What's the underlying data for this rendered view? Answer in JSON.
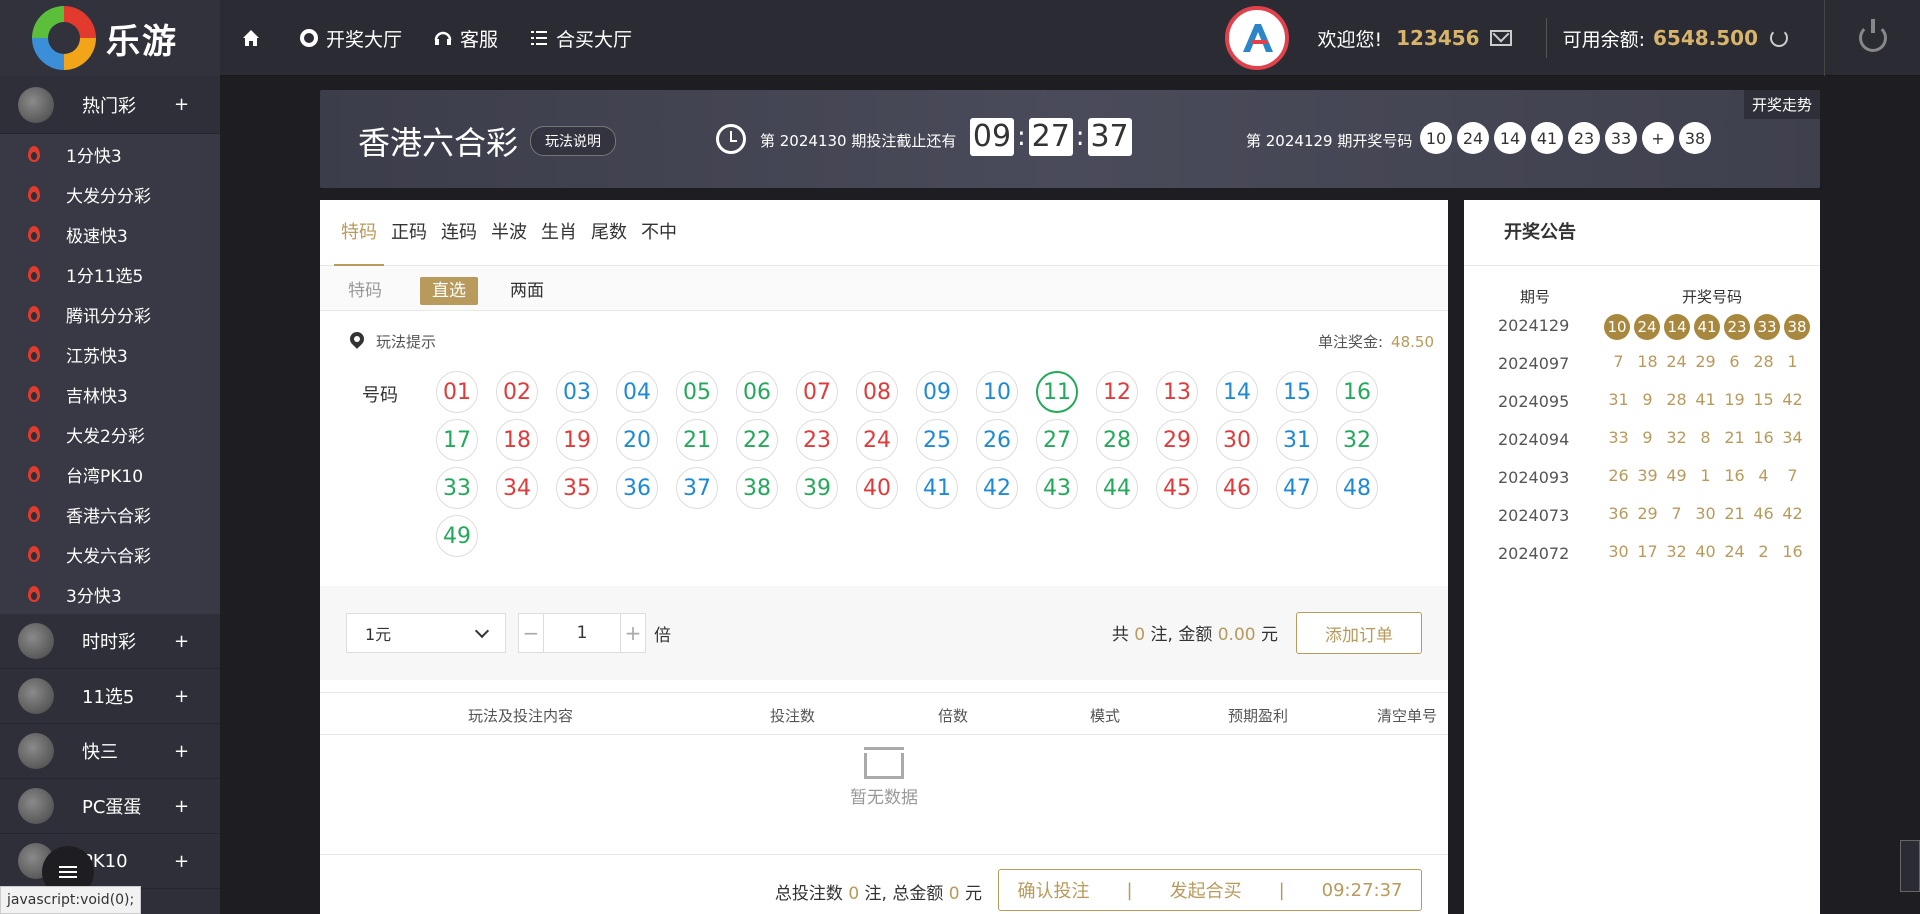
{
  "header": {
    "logo_text": "乐游",
    "nav": [
      {
        "label": "",
        "icon": "home-icon"
      },
      {
        "label": "开奖大厅",
        "icon": "lottery-ball-icon"
      },
      {
        "label": "客服",
        "icon": "headset-icon"
      },
      {
        "label": "合买大厅",
        "icon": "list-icon"
      }
    ],
    "welcome": "欢迎您!",
    "username": "123456",
    "balance_label": "可用余额:",
    "balance": "6548.500"
  },
  "sidebar": {
    "hot": {
      "label": "热门彩",
      "plus": "+"
    },
    "hot_items": [
      "1分快3",
      "大发分分彩",
      "极速快3",
      "1分11选5",
      "腾讯分分彩",
      "江苏快3",
      "吉林快3",
      "大发2分彩",
      "台湾PK10",
      "香港六合彩",
      "大发六合彩",
      "3分快3"
    ],
    "categories": [
      {
        "label": "时时彩",
        "plus": "+"
      },
      {
        "label": "11选5",
        "plus": "+"
      },
      {
        "label": "快三",
        "plus": "+"
      },
      {
        "label": "PC蛋蛋",
        "plus": "+"
      },
      {
        "label": "PK10",
        "plus": "+"
      }
    ],
    "status_url": "javascript:void(0);"
  },
  "banner": {
    "title": "香港六合彩",
    "rule_button": "玩法说明",
    "current_issue_text": "第  2024130  期投注截止还有",
    "countdown": {
      "h": "09",
      "m": "27",
      "s": "37"
    },
    "last_issue_text": "第  2024129  期开奖号码",
    "last_numbers": [
      "10",
      "24",
      "14",
      "41",
      "23",
      "33",
      "+",
      "38"
    ],
    "trend_link": "开奖走势"
  },
  "main": {
    "tabs": [
      "特码",
      "正码",
      "连码",
      "半波",
      "生肖",
      "尾数",
      "不中"
    ],
    "active_tab": 0,
    "subtab_static": "特码",
    "subtabs": [
      "直选",
      "两面"
    ],
    "active_subtab": 0,
    "hint": "玩法提示",
    "prize_label": "单注奖金:",
    "prize_value": "48.50",
    "number_label": "号码",
    "numbers": [
      {
        "n": "01",
        "c": "red"
      },
      {
        "n": "02",
        "c": "red"
      },
      {
        "n": "03",
        "c": "blue"
      },
      {
        "n": "04",
        "c": "blue"
      },
      {
        "n": "05",
        "c": "green"
      },
      {
        "n": "06",
        "c": "green"
      },
      {
        "n": "07",
        "c": "red"
      },
      {
        "n": "08",
        "c": "red"
      },
      {
        "n": "09",
        "c": "blue"
      },
      {
        "n": "10",
        "c": "blue"
      },
      {
        "n": "11",
        "c": "green",
        "selected": true
      },
      {
        "n": "12",
        "c": "red"
      },
      {
        "n": "13",
        "c": "red"
      },
      {
        "n": "14",
        "c": "blue"
      },
      {
        "n": "15",
        "c": "blue"
      },
      {
        "n": "16",
        "c": "green"
      },
      {
        "n": "17",
        "c": "green"
      },
      {
        "n": "18",
        "c": "red"
      },
      {
        "n": "19",
        "c": "red"
      },
      {
        "n": "20",
        "c": "blue"
      },
      {
        "n": "21",
        "c": "green"
      },
      {
        "n": "22",
        "c": "green"
      },
      {
        "n": "23",
        "c": "red"
      },
      {
        "n": "24",
        "c": "red"
      },
      {
        "n": "25",
        "c": "blue"
      },
      {
        "n": "26",
        "c": "blue"
      },
      {
        "n": "27",
        "c": "green"
      },
      {
        "n": "28",
        "c": "green"
      },
      {
        "n": "29",
        "c": "red"
      },
      {
        "n": "30",
        "c": "red"
      },
      {
        "n": "31",
        "c": "blue"
      },
      {
        "n": "32",
        "c": "green"
      },
      {
        "n": "33",
        "c": "green"
      },
      {
        "n": "34",
        "c": "red"
      },
      {
        "n": "35",
        "c": "red"
      },
      {
        "n": "36",
        "c": "blue"
      },
      {
        "n": "37",
        "c": "blue"
      },
      {
        "n": "38",
        "c": "green"
      },
      {
        "n": "39",
        "c": "green"
      },
      {
        "n": "40",
        "c": "red"
      },
      {
        "n": "41",
        "c": "blue"
      },
      {
        "n": "42",
        "c": "blue"
      },
      {
        "n": "43",
        "c": "green"
      },
      {
        "n": "44",
        "c": "green"
      },
      {
        "n": "45",
        "c": "red"
      },
      {
        "n": "46",
        "c": "red"
      },
      {
        "n": "47",
        "c": "blue"
      },
      {
        "n": "48",
        "c": "blue"
      },
      {
        "n": "49",
        "c": "green"
      }
    ],
    "unit": "1元",
    "multiplier": "1",
    "mult_label": "倍",
    "summary_prefix": "共 ",
    "summary_count": "0",
    "summary_mid": " 注, 金额 ",
    "summary_amount": "0.00",
    "summary_suffix": " 元",
    "add_order": "添加订单",
    "order_columns": [
      "玩法及投注内容",
      "投注数",
      "倍数",
      "模式",
      "预期盈利",
      "清空单号"
    ],
    "empty_text": "暂无数据",
    "total_prefix": "总投注数 ",
    "total_count": "0",
    "total_mid": " 注,   总金额 ",
    "total_amount": "0",
    "total_suffix": " 元",
    "confirm": "确认投注",
    "group_buy": "发起合买",
    "divider": "|",
    "timer": "09:27:37"
  },
  "draws": {
    "title": "开奖公告",
    "col_issue": "期号",
    "col_numbers": "开奖号码",
    "rows": [
      {
        "issue": "2024129",
        "nums": [
          "10",
          "24",
          "14",
          "41",
          "23",
          "33",
          "38"
        ],
        "highlight": true
      },
      {
        "issue": "2024097",
        "nums": [
          "7",
          "18",
          "24",
          "29",
          "6",
          "28",
          "1"
        ]
      },
      {
        "issue": "2024095",
        "nums": [
          "31",
          "9",
          "28",
          "41",
          "19",
          "15",
          "42"
        ]
      },
      {
        "issue": "2024094",
        "nums": [
          "33",
          "9",
          "32",
          "8",
          "21",
          "16",
          "34"
        ]
      },
      {
        "issue": "2024093",
        "nums": [
          "26",
          "39",
          "49",
          "1",
          "16",
          "4",
          "7"
        ]
      },
      {
        "issue": "2024073",
        "nums": [
          "36",
          "29",
          "7",
          "30",
          "21",
          "46",
          "42"
        ]
      },
      {
        "issue": "2024072",
        "nums": [
          "30",
          "17",
          "32",
          "40",
          "24",
          "2",
          "16"
        ]
      }
    ]
  },
  "colors": {
    "gold": "#b89a5c",
    "red": "#e13a3a",
    "blue": "#1e8ad6",
    "green": "#23a95a",
    "dark": "#2a2b33"
  }
}
